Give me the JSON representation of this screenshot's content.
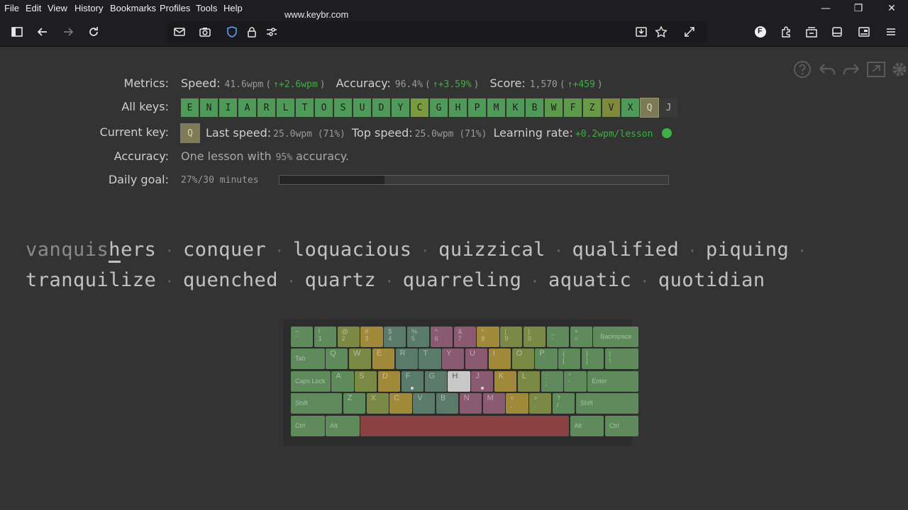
{
  "browser": {
    "menu": [
      "File",
      "Edit",
      "View",
      "History",
      "Bookmarks",
      "Profiles",
      "Tools",
      "Help"
    ],
    "url": "www.keybr.com",
    "profile_initial": "F"
  },
  "stats": {
    "metrics_label": "Metrics:",
    "speed_label": "Speed:",
    "speed_value": "41.6wpm",
    "speed_delta": "↑+2.6wpm",
    "accuracy_label": "Accuracy:",
    "accuracy_value": "96.4%",
    "accuracy_delta": "↑+3.59%",
    "score_label": "Score:",
    "score_value": "1,570",
    "score_delta": "↑+459",
    "all_keys_label": "All keys:",
    "keys": [
      {
        "k": "E",
        "color": "#4f9a58"
      },
      {
        "k": "N",
        "color": "#4f9a58"
      },
      {
        "k": "I",
        "color": "#4f9a58"
      },
      {
        "k": "A",
        "color": "#4f9a58"
      },
      {
        "k": "R",
        "color": "#4f9a58"
      },
      {
        "k": "L",
        "color": "#4f9a58"
      },
      {
        "k": "T",
        "color": "#4f9a58"
      },
      {
        "k": "O",
        "color": "#4f9a58"
      },
      {
        "k": "S",
        "color": "#4f9a58"
      },
      {
        "k": "U",
        "color": "#4f9a58"
      },
      {
        "k": "D",
        "color": "#4f9a58"
      },
      {
        "k": "Y",
        "color": "#4f9a58"
      },
      {
        "k": "C",
        "color": "#7a9a40"
      },
      {
        "k": "G",
        "color": "#4f9a58"
      },
      {
        "k": "H",
        "color": "#4f9a58"
      },
      {
        "k": "P",
        "color": "#4f9a58"
      },
      {
        "k": "M",
        "color": "#4f9a58"
      },
      {
        "k": "K",
        "color": "#4f9a58"
      },
      {
        "k": "B",
        "color": "#4f9a58"
      },
      {
        "k": "W",
        "color": "#5e9a4c"
      },
      {
        "k": "F",
        "color": "#5e9a4c"
      },
      {
        "k": "Z",
        "color": "#6a9a48"
      },
      {
        "k": "V",
        "color": "#7f8a3c"
      },
      {
        "k": "X",
        "color": "#4f9a58"
      },
      {
        "k": "Q",
        "color": "#7a7a55"
      },
      {
        "k": "J",
        "color": "#3a3a3a"
      }
    ],
    "current_key_label": "Current key:",
    "current_key": "Q",
    "last_speed_label": "Last speed:",
    "last_speed_value": "25.0wpm (71%)",
    "top_speed_label": "Top speed:",
    "top_speed_value": "25.0wpm (71%)",
    "learning_rate_label": "Learning rate:",
    "learning_rate_value": "+0.2wpm/lesson",
    "accuracy2_label": "Accuracy:",
    "accuracy2_pre": "One lesson with",
    "accuracy2_value": "95%",
    "accuracy2_post": "accuracy.",
    "daily_goal_label": "Daily goal:",
    "daily_goal_value": "27%/30 minutes",
    "daily_goal_progress": 0.27
  },
  "lesson": {
    "typed": "vanquis",
    "current": "h",
    "rest_first": "ers",
    "line1_words": [
      "conquer",
      "loquacious",
      "quizzical",
      "qualified",
      "piquing"
    ],
    "line2_words": [
      "tranquilize",
      "quenched",
      "quartz",
      "quarreling",
      "aquatic",
      "quotidian"
    ]
  },
  "keyboard": {
    "colors": {
      "green": "#5e8a5c",
      "yellow": "#a08a3a",
      "olive": "#7a8a44",
      "pink": "#8a5a70",
      "teal": "#5a7a6a",
      "grey": "#c8c8c8",
      "red": "#8a4242"
    }
  }
}
